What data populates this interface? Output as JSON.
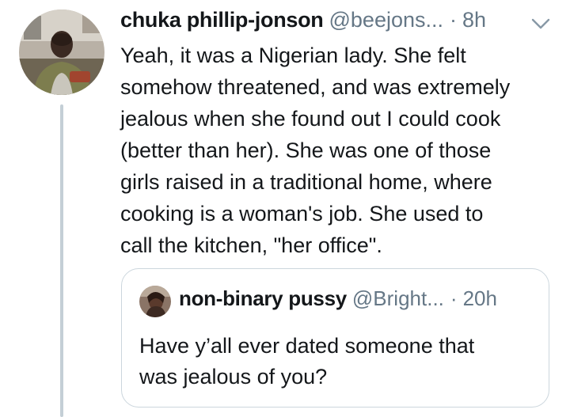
{
  "tweet": {
    "author_name": "chuka phillip-jonson",
    "author_handle": "@beejons...",
    "separator": "·",
    "timestamp": "8h",
    "menu_icon": "chevron-down-icon",
    "text_lines": [
      "Yeah, it was a Nigerian lady. She felt",
      "somehow threatened, and was extremely",
      "jealous when she found out I could cook",
      "(better than her). She was one of those",
      "girls raised in a traditional home, where",
      "cooking is a woman's job. She used to",
      "call the kitchen, \"her office\"."
    ]
  },
  "quoted_tweet": {
    "author_name": "non-binary pussy",
    "author_handle": "@Bright...",
    "separator": "·",
    "timestamp": "20h",
    "text_lines": [
      "Have y’all ever dated someone that",
      "was jealous of you?"
    ]
  },
  "colors": {
    "primary_text": "#14171a",
    "secondary_text": "#657786",
    "border": "#ccd6dd",
    "thread_line": "#c4cfd6",
    "background": "#ffffff"
  }
}
